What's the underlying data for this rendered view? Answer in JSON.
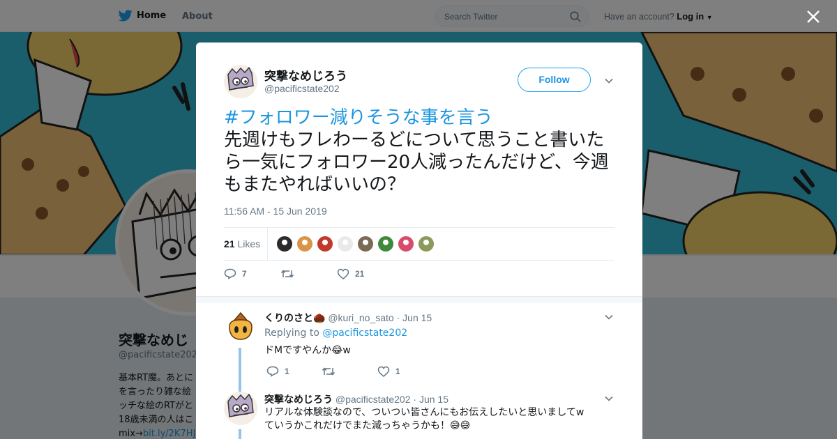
{
  "topbar": {
    "home_label": "Home",
    "about_label": "About",
    "search_placeholder": "Search Twitter",
    "account_prompt": "Have an account?",
    "login_label": "Log in"
  },
  "profile": {
    "name": "突撃なめじ",
    "handle": "@pacificstate202",
    "bio_lines": [
      "基本RT魔。あとに",
      "を言ったり雑な絵",
      "ッチな絵のRTがと",
      "18歳未満の人はこ"
    ],
    "bio_link_prefix": "mix→",
    "bio_link": "bit.ly/2K7HJ"
  },
  "tweet": {
    "author_name": "突撃なめじろう",
    "author_handle": "@pacificstate202",
    "follow_label": "Follow",
    "hashtag": "#フォロワー減りそうな事を言う",
    "body": "先週けもフレわーるどについて思うこと書いたら一気にフォロワー20人減ったんだけど、今週もまたやればいいの？",
    "timestamp": "11:56 AM - 15 Jun 2019",
    "likes_count": "21",
    "likes_label": "Likes",
    "reply_count": "7",
    "retweet_count": "",
    "like_count": "21",
    "liker_colors": [
      "#2b2b2b",
      "#d9944a",
      "#c0392b",
      "#e9e9e9",
      "#7a6a55",
      "#3f8a3a",
      "#d94b6a",
      "#8a9a5b"
    ]
  },
  "replies": [
    {
      "name": "くりのさと🌰",
      "handle": "@kuri_no_sato",
      "date": "· Jun 15",
      "replying_prefix": "Replying to",
      "replying_to": "@pacificstate202",
      "text": "ドMですやんか😂w",
      "reply_count": "1",
      "retweet_count": "",
      "like_count": "1"
    },
    {
      "name": "突撃なめじろう",
      "handle": "@pacificstate202",
      "date": "· Jun 15",
      "text_line1": "リアルな体験談なので、ついつい皆さんにもお伝えしたいと思いましてw",
      "text_line2": "ていうかこれだけでまた減っちゃうかも！😅😅"
    }
  ],
  "colors": {
    "accent": "#1da1f2",
    "link": "#1b95e0",
    "banner": "#36bcd6",
    "text": "#14171a",
    "muted": "#657786"
  }
}
